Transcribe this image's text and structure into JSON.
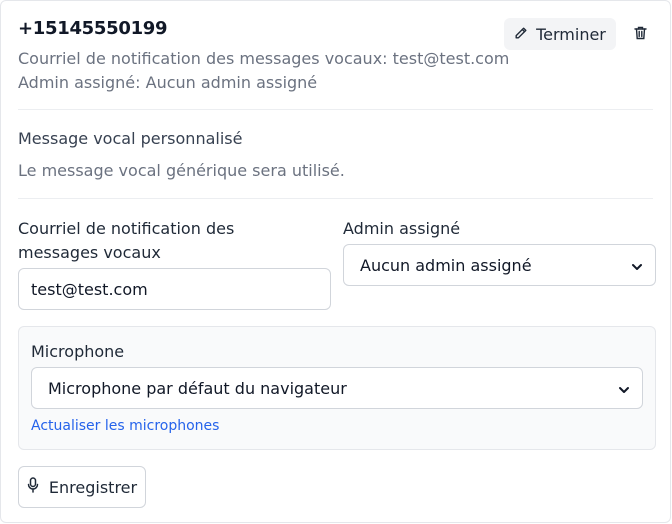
{
  "header": {
    "phone_number": "+15145550199",
    "notification_email_line": "Courriel de notification des messages vocaux: test@test.com",
    "assigned_admin_line": "Admin assigné: Aucun admin assigné",
    "finish_label": "Terminer",
    "icons": {
      "finish": "pencil-icon",
      "delete": "trash-icon"
    }
  },
  "custom_voicemail": {
    "title": "Message vocal personnalisé",
    "description": "Le message vocal générique sera utilisé."
  },
  "form": {
    "email_label": "Courriel de notification des messages vocaux",
    "email_value": "test@test.com",
    "admin_label": "Admin assigné",
    "admin_selected": "Aucun admin assigné"
  },
  "microphone": {
    "label": "Microphone",
    "selected": "Microphone par défaut du navigateur",
    "refresh_label": "Actualiser les microphones"
  },
  "record": {
    "label": "Enregistrer",
    "icon": "microphone-icon"
  },
  "colors": {
    "link": "#2563eb",
    "muted_text": "#6b7280",
    "border": "#d1d5db",
    "panel_bg": "#f9fafb"
  }
}
